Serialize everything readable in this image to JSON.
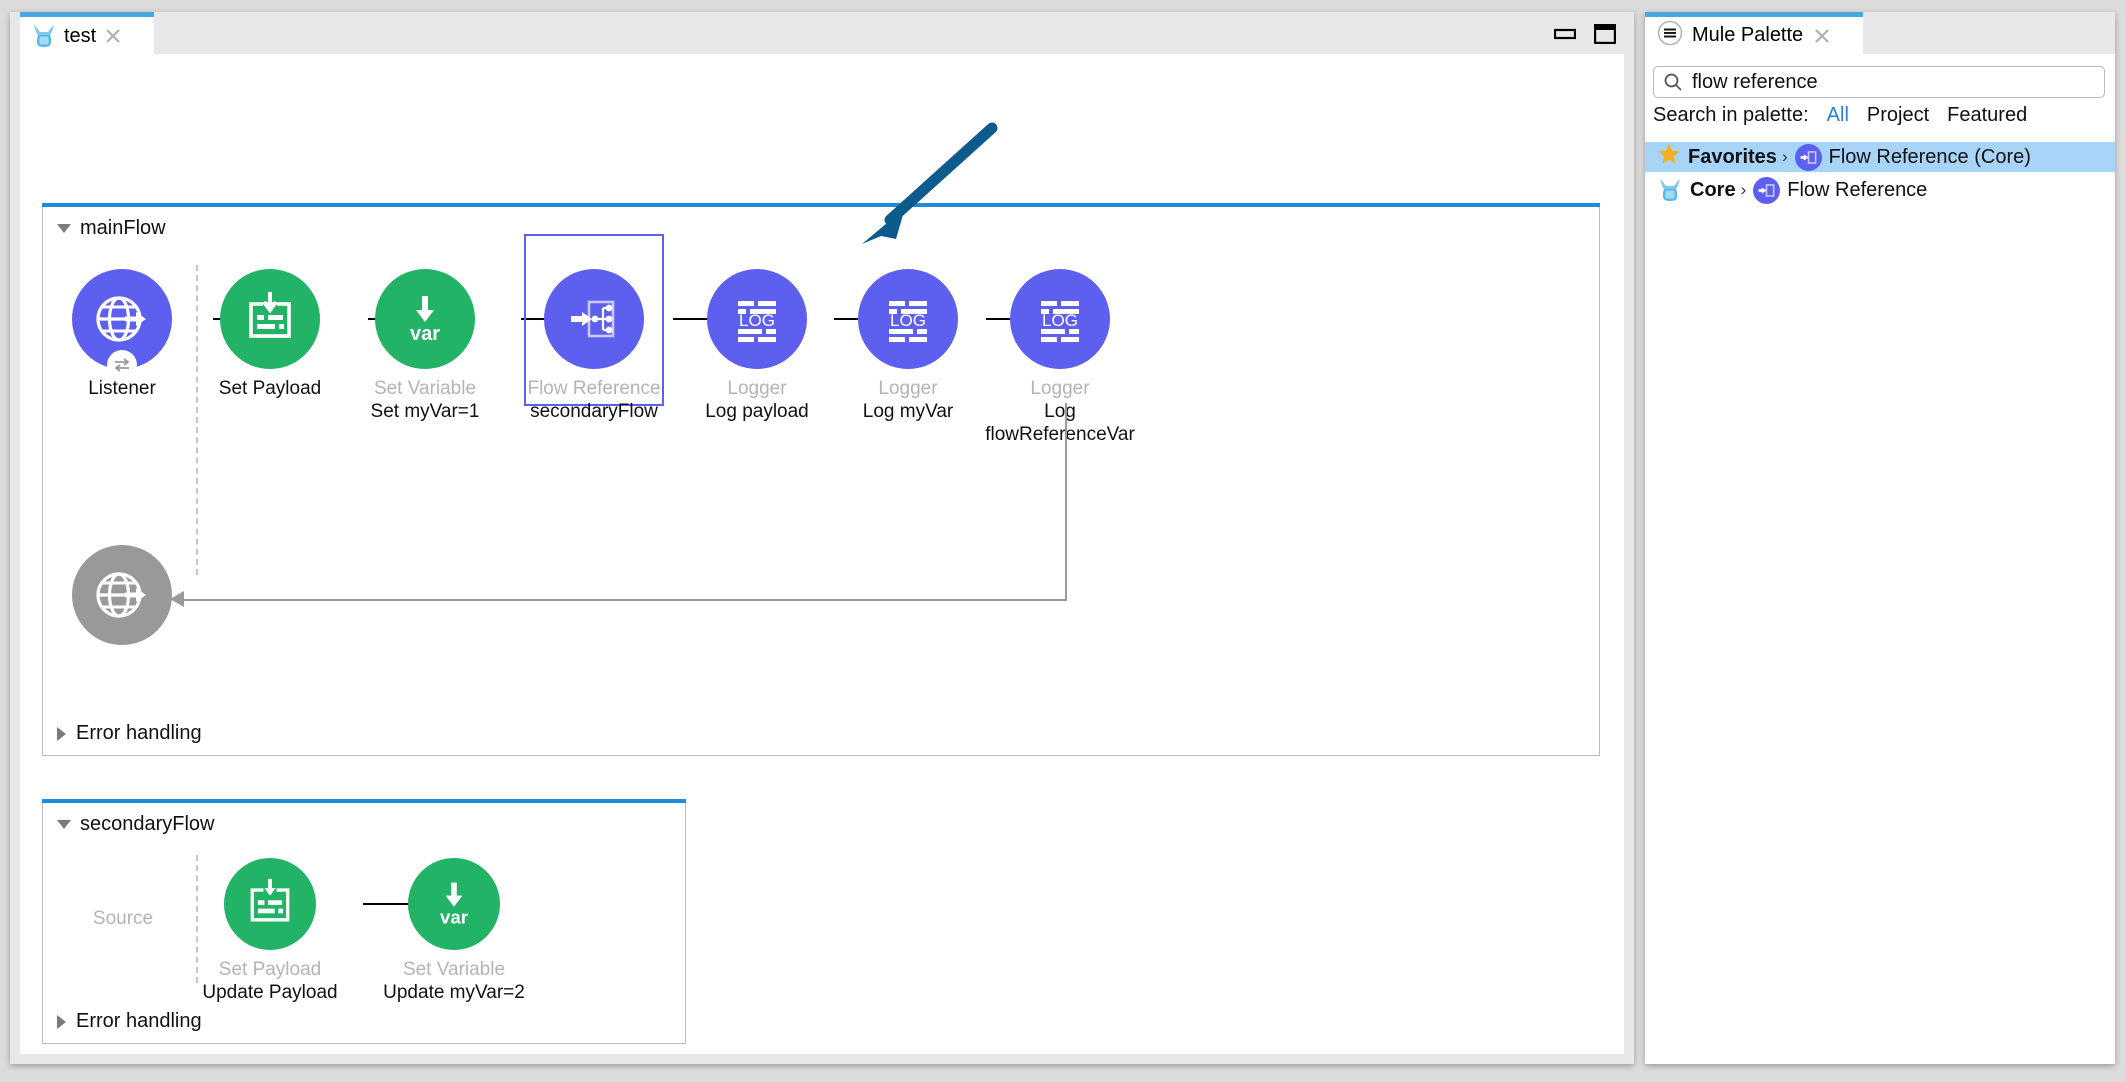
{
  "editor": {
    "tab": {
      "label": "test",
      "icon": "mule-icon",
      "close_icon": "close-icon"
    },
    "window_controls": {
      "minimize": "minimize-icon",
      "maximize": "maximize-icon"
    }
  },
  "flows": [
    {
      "name": "mainFlow",
      "collapse_icon": "triangle-down-icon",
      "error_handling_label": "Error handling",
      "error_handling_icon": "triangle-right-icon",
      "source": {
        "type": "Listener",
        "desc": "",
        "icon": "globe-arrow-icon",
        "color": "#5d5fef",
        "badge": "exchange-icon"
      },
      "response": {
        "type": "",
        "icon": "globe-arrow-icon",
        "color": "#999999"
      },
      "steps": [
        {
          "type": "Set Payload",
          "desc": "",
          "icon": "set-payload-icon",
          "color": "#22b366",
          "type_dark": true,
          "selected": false
        },
        {
          "type": "Set Variable",
          "desc": "Set myVar=1",
          "icon": "set-variable-icon",
          "color": "#22b366",
          "type_dark": false,
          "selected": false
        },
        {
          "type": "Flow Reference",
          "desc": "secondaryFlow",
          "icon": "flow-reference-icon",
          "color": "#5d5fef",
          "type_dark": false,
          "selected": true
        },
        {
          "type": "Logger",
          "desc": "Log payload",
          "icon": "logger-icon",
          "color": "#5d5fef",
          "type_dark": false,
          "selected": false
        },
        {
          "type": "Logger",
          "desc": "Log myVar",
          "icon": "logger-icon",
          "color": "#5d5fef",
          "type_dark": false,
          "selected": false
        },
        {
          "type": "Logger",
          "desc": "Log flowReferenceVar",
          "icon": "logger-icon",
          "color": "#5d5fef",
          "type_dark": false,
          "selected": false
        }
      ]
    },
    {
      "name": "secondaryFlow",
      "collapse_icon": "triangle-down-icon",
      "error_handling_label": "Error handling",
      "error_handling_icon": "triangle-right-icon",
      "source_placeholder": "Source",
      "steps": [
        {
          "type": "Set Payload",
          "desc": "Update Payload",
          "icon": "set-payload-icon",
          "color": "#22b366"
        },
        {
          "type": "Set Variable",
          "desc": "Update myVar=2",
          "icon": "set-variable-icon",
          "color": "#22b366"
        }
      ]
    }
  ],
  "palette": {
    "tab": {
      "label": "Mule Palette",
      "menu_icon": "hamburger-circle-icon",
      "close_icon": "close-icon"
    },
    "search": {
      "value": "flow reference",
      "placeholder": "Search in palette",
      "icon": "search-icon"
    },
    "filter": {
      "label": "Search in palette:",
      "options": [
        "All",
        "Project",
        "Featured"
      ],
      "active": "All"
    },
    "results": [
      {
        "category": "Favorites",
        "category_icon": "star-icon",
        "chevron": "›",
        "item": "Flow Reference (Core)",
        "item_icon": "flow-reference-icon",
        "selected": true
      },
      {
        "category": "Core",
        "category_icon": "mule-icon",
        "chevron": "›",
        "item": "Flow Reference",
        "item_icon": "flow-reference-icon",
        "selected": false
      }
    ]
  },
  "annotation": {
    "arrow_color": "#0d5a8c",
    "name": "callout-arrow"
  },
  "colors": {
    "accent_blue": "#1e8bde",
    "purple": "#5d5fef",
    "green": "#22b366",
    "gray_node": "#999999",
    "selection_blue": "#a8d4f7",
    "link_blue": "#2a7fd4"
  }
}
